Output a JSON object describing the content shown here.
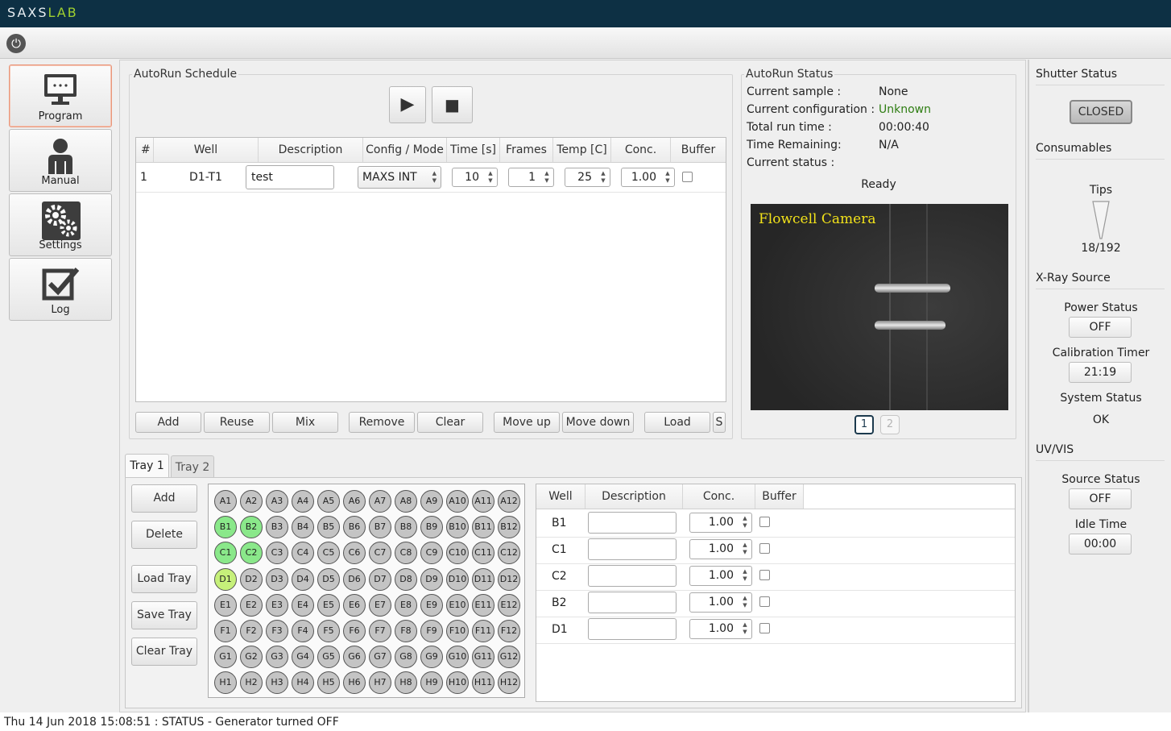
{
  "app": {
    "logo_a": "SAXS",
    "logo_b": "LAB"
  },
  "nav": [
    {
      "label": "Program",
      "icon": "monitor-icon"
    },
    {
      "label": "Manual",
      "icon": "person-icon"
    },
    {
      "label": "Settings",
      "icon": "gears-icon"
    },
    {
      "label": "Log",
      "icon": "checkbox-icon"
    }
  ],
  "schedule": {
    "title": "AutoRun Schedule",
    "columns": [
      "#",
      "Well",
      "Description",
      "Config / Mode",
      "Time [s]",
      "Frames",
      "Temp [C]",
      "Conc.",
      "Buffer"
    ],
    "rows": [
      {
        "num": "1",
        "well": "D1-T1",
        "description": "test",
        "config": "MAXS INT",
        "time": "10",
        "frames": "1",
        "temp": "25",
        "conc": "1.00",
        "buffer": false
      }
    ],
    "buttons": [
      "Add",
      "Reuse",
      "Mix",
      "Remove",
      "Clear",
      "Move up",
      "Move down",
      "Load",
      "S"
    ]
  },
  "status": {
    "title": "AutoRun Status",
    "fields": [
      {
        "label": "Current sample :",
        "value": "None"
      },
      {
        "label": "Current configuration :",
        "value": "Unknown"
      },
      {
        "label": "Total run time :",
        "value": "00:00:40"
      },
      {
        "label": "Time Remaining:",
        "value": "N/A"
      },
      {
        "label": "Current status :",
        "value": ""
      }
    ],
    "state": "Ready",
    "camera_label": "Flowcell Camera",
    "pages": [
      "1",
      "2"
    ],
    "unknown_color": "#2e7d12"
  },
  "tray": {
    "tabs": [
      "Tray 1",
      "Tray 2"
    ],
    "buttons": [
      "Add",
      "Delete",
      "Load Tray",
      "Save Tray",
      "Clear Tray"
    ],
    "rows": [
      "A",
      "B",
      "C",
      "D",
      "E",
      "F",
      "G",
      "H"
    ],
    "cols": 12,
    "selected": [
      "B1",
      "B2",
      "C1",
      "C2"
    ],
    "current": [
      "D1"
    ],
    "table_columns": [
      "Well",
      "Description",
      "Conc.",
      "Buffer"
    ],
    "table_rows": [
      {
        "well": "B1",
        "description": "",
        "conc": "1.00",
        "buffer": false
      },
      {
        "well": "C1",
        "description": "",
        "conc": "1.00",
        "buffer": false
      },
      {
        "well": "C2",
        "description": "",
        "conc": "1.00",
        "buffer": false
      },
      {
        "well": "B2",
        "description": "",
        "conc": "1.00",
        "buffer": false
      },
      {
        "well": "D1",
        "description": "",
        "conc": "1.00",
        "buffer": false
      }
    ]
  },
  "right": {
    "shutter_title": "Shutter Status",
    "shutter_value": "CLOSED",
    "consumables_title": "Consumables",
    "tips_label": "Tips",
    "tips_value": "18/192",
    "xray_title": "X-Ray Source",
    "power_label": "Power Status",
    "power_value": "OFF",
    "calib_label": "Calibration Timer",
    "calib_value": "21:19",
    "system_label": "System Status",
    "system_value": "OK",
    "uvvis_title": "UV/VIS",
    "source_label": "Source Status",
    "source_value": "OFF",
    "idle_label": "Idle Time",
    "idle_value": "00:00"
  },
  "statusbar": {
    "text": "Thu 14 Jun 2018 15:08:51 : STATUS - Generator turned OFF"
  }
}
